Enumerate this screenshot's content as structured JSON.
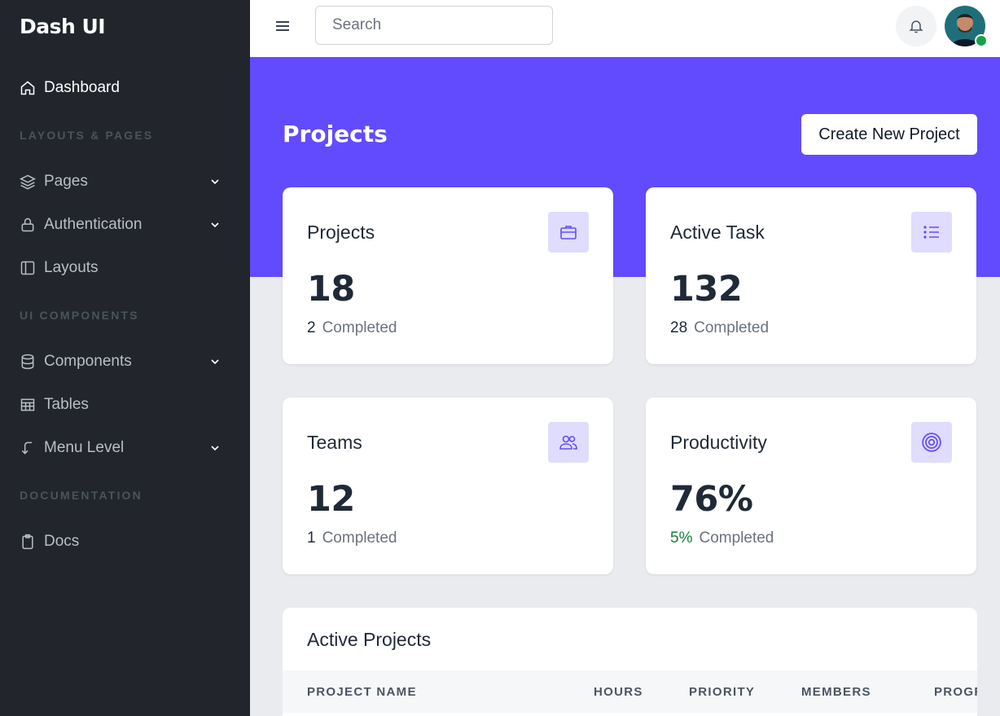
{
  "brand": "Dash UI",
  "sidebar": {
    "dashboard": "Dashboard",
    "section_layouts": "LAYOUTS & PAGES",
    "pages": "Pages",
    "authentication": "Authentication",
    "layouts": "Layouts",
    "section_ui": "UI COMPONENTS",
    "components": "Components",
    "tables": "Tables",
    "menu_level": "Menu Level",
    "section_docs": "DOCUMENTATION",
    "docs": "Docs"
  },
  "topbar": {
    "search_placeholder": "Search"
  },
  "page": {
    "title": "Projects",
    "create_button": "Create New Project"
  },
  "cards": {
    "projects": {
      "title": "Projects",
      "value": "18",
      "completed_num": "2",
      "completed_label": "Completed",
      "icon": "briefcase-icon"
    },
    "active_task": {
      "title": "Active Task",
      "value": "132",
      "completed_num": "28",
      "completed_label": "Completed",
      "icon": "list-icon"
    },
    "teams": {
      "title": "Teams",
      "value": "12",
      "completed_num": "1",
      "completed_label": "Completed",
      "icon": "people-icon"
    },
    "productivity": {
      "title": "Productivity",
      "value": "76%",
      "completed_num": "5%",
      "completed_label": "Completed",
      "icon": "target-icon"
    }
  },
  "active_projects": {
    "title": "Active Projects",
    "columns": [
      "PROJECT NAME",
      "HOURS",
      "PRIORITY",
      "MEMBERS",
      "PROGR"
    ]
  },
  "colors": {
    "accent": "#624bff",
    "sidebar_bg": "#22262c",
    "icon_bg": "#e0dcfe",
    "success": "#15803d"
  }
}
